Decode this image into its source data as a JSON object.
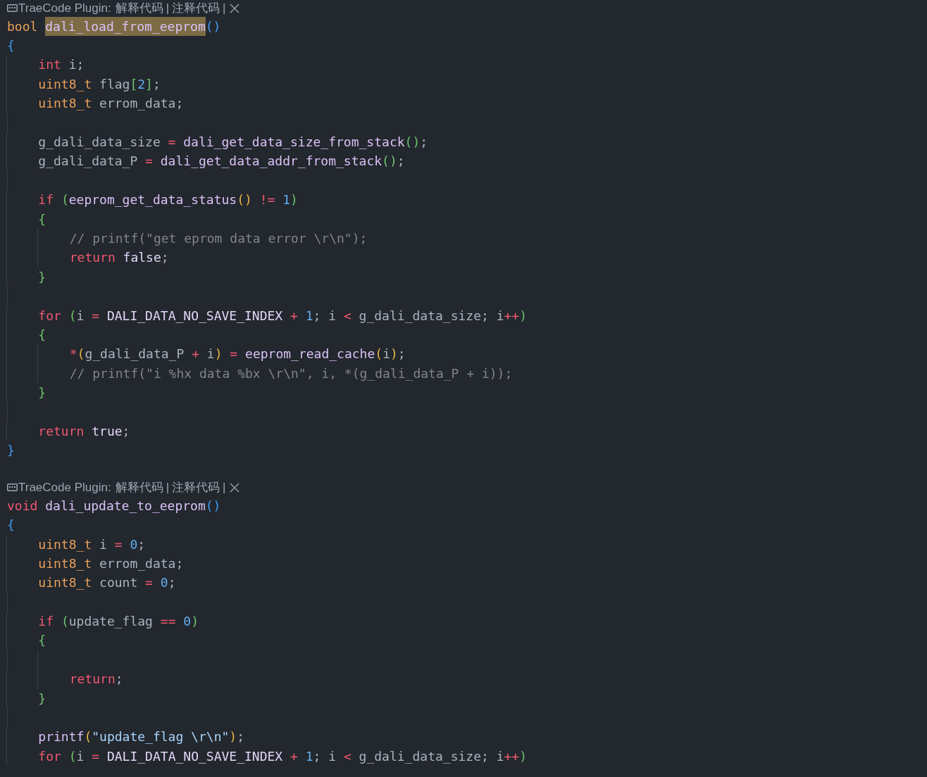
{
  "blocks": [
    {
      "codelens": [
        {
          "kind": "label",
          "text": "TraeCode Plugin:"
        },
        {
          "kind": "action",
          "text": "解释代码"
        },
        {
          "kind": "sep",
          "text": "|"
        },
        {
          "kind": "action",
          "text": "注释代码"
        },
        {
          "kind": "sep",
          "text": "|"
        },
        {
          "kind": "close"
        }
      ],
      "lines": [
        {
          "kind": "code",
          "tokens": [
            {
              "kind": "type",
              "text": "bool "
            },
            {
              "kind": "match",
              "text": "dali_load_from_eeprom"
            },
            {
              "kind": "b1",
              "text": "()"
            }
          ]
        },
        {
          "kind": "code",
          "tokens": [
            {
              "kind": "b1",
              "text": "{"
            }
          ]
        },
        {
          "kind": "code",
          "tokens": [
            {
              "kind": "kw",
              "text": "    int "
            },
            {
              "kind": "p",
              "text": "i;"
            }
          ]
        },
        {
          "kind": "code",
          "tokens": [
            {
              "kind": "type",
              "text": "    uint8_t "
            },
            {
              "kind": "p",
              "text": "flag"
            },
            {
              "kind": "b2",
              "text": "["
            },
            {
              "kind": "num",
              "text": "2"
            },
            {
              "kind": "b2",
              "text": "]"
            },
            {
              "kind": "p",
              "text": ";"
            }
          ]
        },
        {
          "kind": "code",
          "tokens": [
            {
              "kind": "type",
              "text": "    uint8_t "
            },
            {
              "kind": "p",
              "text": "errom_data;"
            }
          ]
        },
        {
          "kind": "blank"
        },
        {
          "kind": "code",
          "tokens": [
            {
              "kind": "p",
              "text": "    g_dali_data_size "
            },
            {
              "kind": "op",
              "text": "= "
            },
            {
              "kind": "fn",
              "text": "dali_get_data_size_from_stack"
            },
            {
              "kind": "b2",
              "text": "()"
            },
            {
              "kind": "p",
              "text": ";"
            }
          ]
        },
        {
          "kind": "code",
          "tokens": [
            {
              "kind": "p",
              "text": "    g_dali_data_P "
            },
            {
              "kind": "op",
              "text": "= "
            },
            {
              "kind": "fn",
              "text": "dali_get_data_addr_from_stack"
            },
            {
              "kind": "b2",
              "text": "()"
            },
            {
              "kind": "p",
              "text": ";"
            }
          ]
        },
        {
          "kind": "blank"
        },
        {
          "kind": "code",
          "tokens": [
            {
              "kind": "kw",
              "text": "    if "
            },
            {
              "kind": "b2",
              "text": "("
            },
            {
              "kind": "fn",
              "text": "eeprom_get_data_status"
            },
            {
              "kind": "b3",
              "text": "() "
            },
            {
              "kind": "op",
              "text": "!= "
            },
            {
              "kind": "num",
              "text": "1"
            },
            {
              "kind": "b2",
              "text": ")"
            }
          ]
        },
        {
          "kind": "code",
          "tokens": [
            {
              "kind": "b2",
              "text": "    {"
            }
          ]
        },
        {
          "kind": "code",
          "tokens": [
            {
              "kind": "com",
              "text": "        // printf(\"get eprom data error \\r\\n\");"
            }
          ]
        },
        {
          "kind": "code",
          "tokens": [
            {
              "kind": "kw",
              "text": "        return "
            },
            {
              "kind": "const",
              "text": "false"
            },
            {
              "kind": "p",
              "text": ";"
            }
          ]
        },
        {
          "kind": "code",
          "tokens": [
            {
              "kind": "b2",
              "text": "    }"
            }
          ]
        },
        {
          "kind": "blank"
        },
        {
          "kind": "code",
          "tokens": [
            {
              "kind": "kw",
              "text": "    for "
            },
            {
              "kind": "b2",
              "text": "("
            },
            {
              "kind": "p",
              "text": "i "
            },
            {
              "kind": "op",
              "text": "= "
            },
            {
              "kind": "const",
              "text": "DALI_DATA_NO_SAVE_INDEX "
            },
            {
              "kind": "op",
              "text": "+ "
            },
            {
              "kind": "num",
              "text": "1"
            },
            {
              "kind": "p",
              "text": "; i "
            },
            {
              "kind": "op",
              "text": "< "
            },
            {
              "kind": "p",
              "text": "g_dali_data_size; i"
            },
            {
              "kind": "op",
              "text": "++"
            },
            {
              "kind": "b2",
              "text": ")"
            }
          ]
        },
        {
          "kind": "code",
          "tokens": [
            {
              "kind": "b2",
              "text": "    {"
            }
          ]
        },
        {
          "kind": "code",
          "tokens": [
            {
              "kind": "op",
              "text": "        *"
            },
            {
              "kind": "b3",
              "text": "("
            },
            {
              "kind": "p",
              "text": "g_dali_data_P "
            },
            {
              "kind": "op",
              "text": "+ "
            },
            {
              "kind": "p",
              "text": "i"
            },
            {
              "kind": "b3",
              "text": ") "
            },
            {
              "kind": "op",
              "text": "= "
            },
            {
              "kind": "fn",
              "text": "eeprom_read_cache"
            },
            {
              "kind": "b3",
              "text": "("
            },
            {
              "kind": "p",
              "text": "i"
            },
            {
              "kind": "b3",
              "text": ")"
            },
            {
              "kind": "p",
              "text": ";"
            }
          ]
        },
        {
          "kind": "code",
          "tokens": [
            {
              "kind": "com",
              "text": "        // printf(\"i %hx data %bx \\r\\n\", i, *(g_dali_data_P + i));"
            }
          ]
        },
        {
          "kind": "code",
          "tokens": [
            {
              "kind": "b2",
              "text": "    }"
            }
          ]
        },
        {
          "kind": "blank"
        },
        {
          "kind": "code",
          "tokens": [
            {
              "kind": "kw",
              "text": "    return "
            },
            {
              "kind": "const",
              "text": "true"
            },
            {
              "kind": "p",
              "text": ";"
            }
          ]
        },
        {
          "kind": "code",
          "tokens": [
            {
              "kind": "b1",
              "text": "}"
            }
          ]
        },
        {
          "kind": "blank"
        }
      ]
    },
    {
      "codelens": [
        {
          "kind": "label",
          "text": "TraeCode Plugin:"
        },
        {
          "kind": "action",
          "text": "解释代码"
        },
        {
          "kind": "sep",
          "text": "|"
        },
        {
          "kind": "action",
          "text": "注释代码"
        },
        {
          "kind": "sep",
          "text": "|"
        },
        {
          "kind": "close"
        }
      ],
      "lines": [
        {
          "kind": "code",
          "tokens": [
            {
              "kind": "kw",
              "text": "void "
            },
            {
              "kind": "fn",
              "text": "dali_update_to_eeprom"
            },
            {
              "kind": "b1",
              "text": "()"
            }
          ]
        },
        {
          "kind": "code",
          "tokens": [
            {
              "kind": "b1",
              "text": "{"
            }
          ]
        },
        {
          "kind": "code",
          "tokens": [
            {
              "kind": "type",
              "text": "    uint8_t "
            },
            {
              "kind": "p",
              "text": "i "
            },
            {
              "kind": "op",
              "text": "= "
            },
            {
              "kind": "num",
              "text": "0"
            },
            {
              "kind": "p",
              "text": ";"
            }
          ]
        },
        {
          "kind": "code",
          "tokens": [
            {
              "kind": "type",
              "text": "    uint8_t "
            },
            {
              "kind": "p",
              "text": "errom_data;"
            }
          ]
        },
        {
          "kind": "code",
          "tokens": [
            {
              "kind": "type",
              "text": "    uint8_t "
            },
            {
              "kind": "p",
              "text": "count "
            },
            {
              "kind": "op",
              "text": "= "
            },
            {
              "kind": "num",
              "text": "0"
            },
            {
              "kind": "p",
              "text": ";"
            }
          ]
        },
        {
          "kind": "blank"
        },
        {
          "kind": "code",
          "tokens": [
            {
              "kind": "kw",
              "text": "    if "
            },
            {
              "kind": "b2",
              "text": "("
            },
            {
              "kind": "p",
              "text": "update_flag "
            },
            {
              "kind": "op",
              "text": "== "
            },
            {
              "kind": "num",
              "text": "0"
            },
            {
              "kind": "b2",
              "text": ")"
            }
          ]
        },
        {
          "kind": "code",
          "tokens": [
            {
              "kind": "b2",
              "text": "    {"
            }
          ]
        },
        {
          "kind": "blank"
        },
        {
          "kind": "code",
          "tokens": [
            {
              "kind": "kw",
              "text": "        return"
            },
            {
              "kind": "p",
              "text": ";"
            }
          ]
        },
        {
          "kind": "code",
          "tokens": [
            {
              "kind": "b2",
              "text": "    }"
            }
          ]
        },
        {
          "kind": "blank"
        },
        {
          "kind": "code",
          "tokens": [
            {
              "kind": "fn",
              "text": "    printf"
            },
            {
              "kind": "b3",
              "text": "("
            },
            {
              "kind": "str",
              "text": "\"update_flag \\r\\n\""
            },
            {
              "kind": "b3",
              "text": ")"
            },
            {
              "kind": "p",
              "text": ";"
            }
          ]
        },
        {
          "kind": "code",
          "tokens": [
            {
              "kind": "kw",
              "text": "    for "
            },
            {
              "kind": "b2",
              "text": "("
            },
            {
              "kind": "p",
              "text": "i "
            },
            {
              "kind": "op",
              "text": "= "
            },
            {
              "kind": "const",
              "text": "DALI_DATA_NO_SAVE_INDEX "
            },
            {
              "kind": "op",
              "text": "+ "
            },
            {
              "kind": "num",
              "text": "1"
            },
            {
              "kind": "p",
              "text": "; i "
            },
            {
              "kind": "op",
              "text": "< "
            },
            {
              "kind": "p",
              "text": "g_dali_data_size; i"
            },
            {
              "kind": "op",
              "text": "++"
            },
            {
              "kind": "b2",
              "text": ")"
            }
          ]
        }
      ]
    }
  ]
}
